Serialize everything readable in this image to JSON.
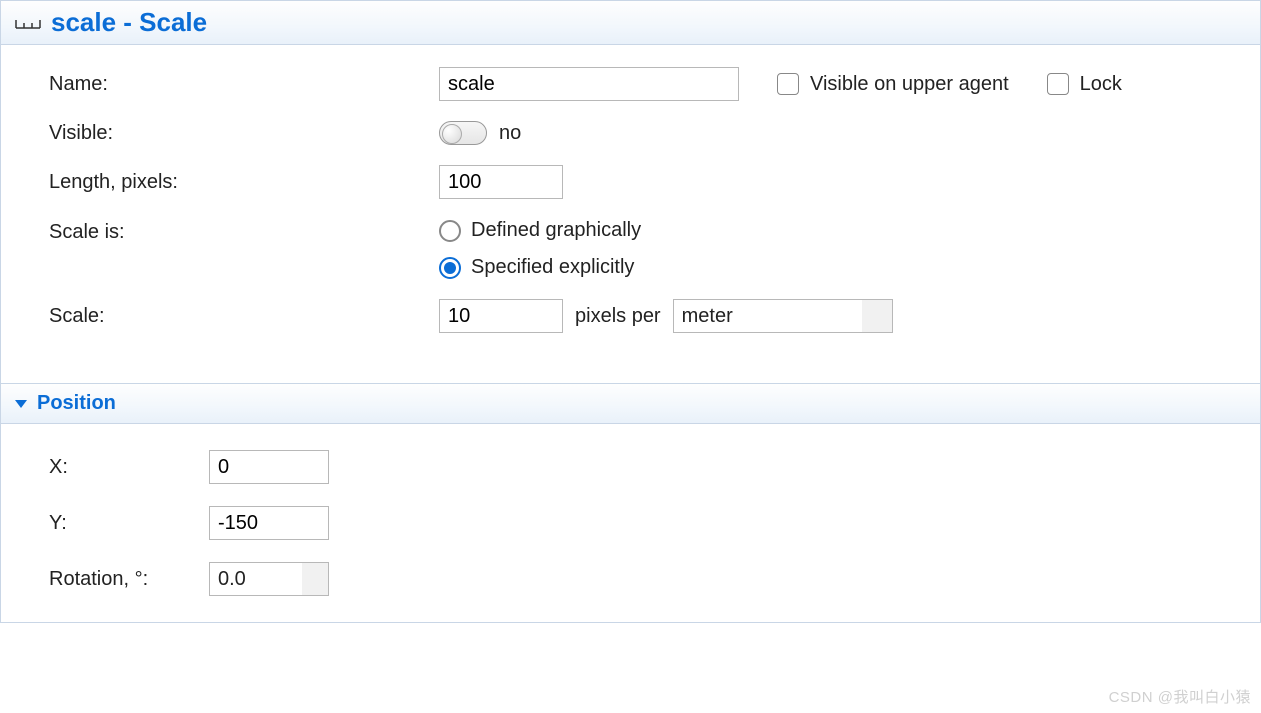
{
  "header": {
    "title": "scale - Scale"
  },
  "fields": {
    "name_label": "Name:",
    "name_value": "scale",
    "visible_upper_label": "Visible on upper agent",
    "lock_label": "Lock",
    "visible_label": "Visible:",
    "visible_value": "no",
    "length_label": "Length, pixels:",
    "length_value": "100",
    "scaleis_label": "Scale is:",
    "scaleis_option1": "Defined graphically",
    "scaleis_option2": "Specified explicitly",
    "scale_label": "Scale:",
    "scale_value": "10",
    "pixels_per_label": "pixels per",
    "unit_value": "meter"
  },
  "position": {
    "section_title": "Position",
    "x_label": "X:",
    "x_value": "0",
    "y_label": "Y:",
    "y_value": "-150",
    "rotation_label": "Rotation, °:",
    "rotation_value": "0.0"
  },
  "watermark": "CSDN @我叫白小猿"
}
